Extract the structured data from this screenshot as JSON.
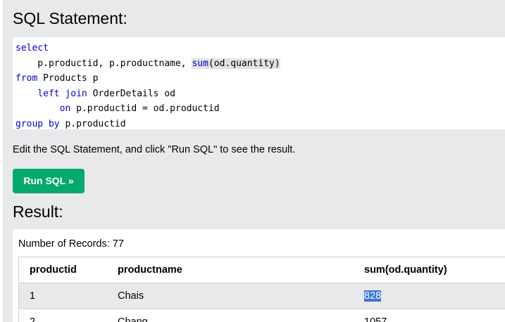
{
  "sql_section": {
    "title": "SQL Statement:",
    "code_lines": [
      [
        {
          "t": "select",
          "k": true
        }
      ],
      [
        {
          "t": "    p.productid, p.productname, ",
          "k": false
        },
        {
          "t": "sum",
          "k": true,
          "hl": true
        },
        {
          "t": "(od.quantity)",
          "k": false,
          "hl": true
        }
      ],
      [
        {
          "t": "from",
          "k": true
        },
        {
          "t": " Products p",
          "k": false
        }
      ],
      [
        {
          "t": "    ",
          "k": false
        },
        {
          "t": "left join",
          "k": true
        },
        {
          "t": " OrderDetails od",
          "k": false
        }
      ],
      [
        {
          "t": "        ",
          "k": false
        },
        {
          "t": "on",
          "k": true
        },
        {
          "t": " p.productid = od.productid",
          "k": false
        }
      ],
      [
        {
          "t": "group by",
          "k": true
        },
        {
          "t": " p.productid",
          "k": false
        }
      ]
    ]
  },
  "hint_text": "Edit the SQL Statement, and click \"Run SQL\" to see the result.",
  "run_button_label": "Run SQL »",
  "result_section": {
    "title": "Result:",
    "record_count": "Number of Records: 77",
    "columns": [
      "productid",
      "productname",
      "sum(od.quantity)"
    ],
    "rows": [
      [
        "1",
        "Chais",
        "828"
      ],
      [
        "2",
        "Chang",
        "1057"
      ]
    ],
    "selected_cell": "828"
  },
  "colors": {
    "page_bg": "#e7e9eb",
    "button_bg": "#04aa6d",
    "keyword": "#0000cd",
    "selection": "#3875d7"
  }
}
